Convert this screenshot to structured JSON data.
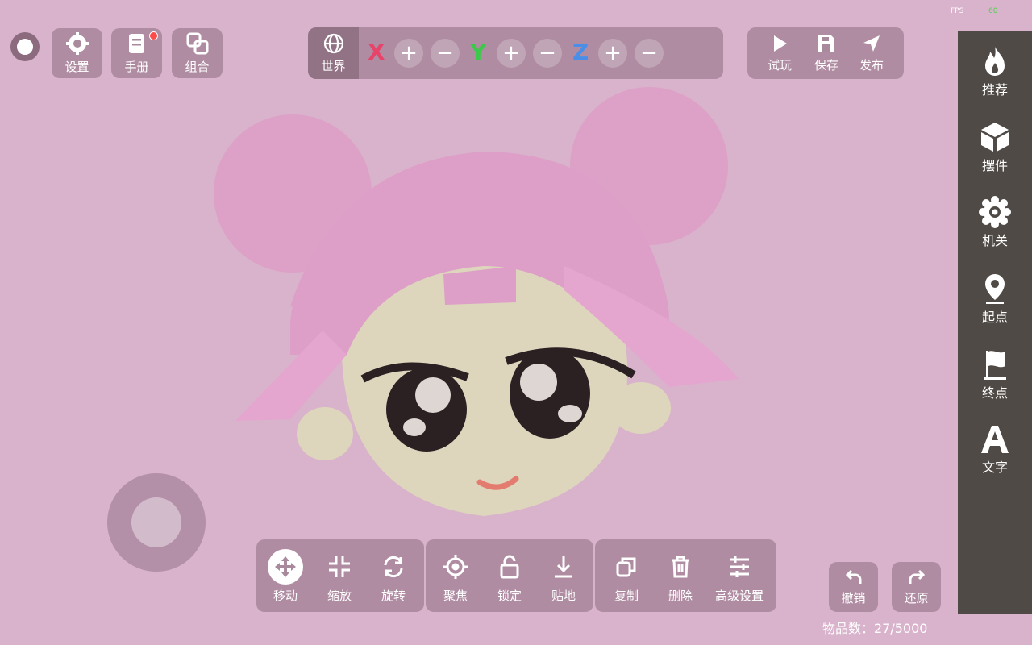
{
  "hud": {
    "fps_label": "FPS",
    "fps_value": "60"
  },
  "top_left": {
    "settings_label": "设置",
    "manual_label": "手册",
    "combine_label": "组合"
  },
  "axis_bar": {
    "world_label": "世界",
    "x": "X",
    "y": "Y",
    "z": "Z",
    "plus": "+",
    "minus": "−",
    "colors": {
      "x": "#e8436a",
      "y": "#3cc84a",
      "z": "#4a8ee8"
    }
  },
  "top_right": {
    "play_label": "试玩",
    "save_label": "保存",
    "publish_label": "发布"
  },
  "sidebar": {
    "items": [
      {
        "label": "推荐",
        "icon": "flame-icon"
      },
      {
        "label": "摆件",
        "icon": "cube-icon"
      },
      {
        "label": "机关",
        "icon": "gear-icon"
      },
      {
        "label": "起点",
        "icon": "location-pin-icon"
      },
      {
        "label": "终点",
        "icon": "flag-icon"
      },
      {
        "label": "文字",
        "icon": "letter-a-icon"
      }
    ]
  },
  "bottom_toolbar": {
    "move_label": "移动",
    "scale_label": "缩放",
    "rotate_label": "旋转",
    "focus_label": "聚焦",
    "lock_label": "锁定",
    "ground_label": "贴地",
    "copy_label": "复制",
    "delete_label": "删除",
    "advanced_label": "高级设置"
  },
  "history": {
    "undo_label": "撤销",
    "redo_label": "还原"
  },
  "status": {
    "item_count": "物品数：27/5000"
  }
}
